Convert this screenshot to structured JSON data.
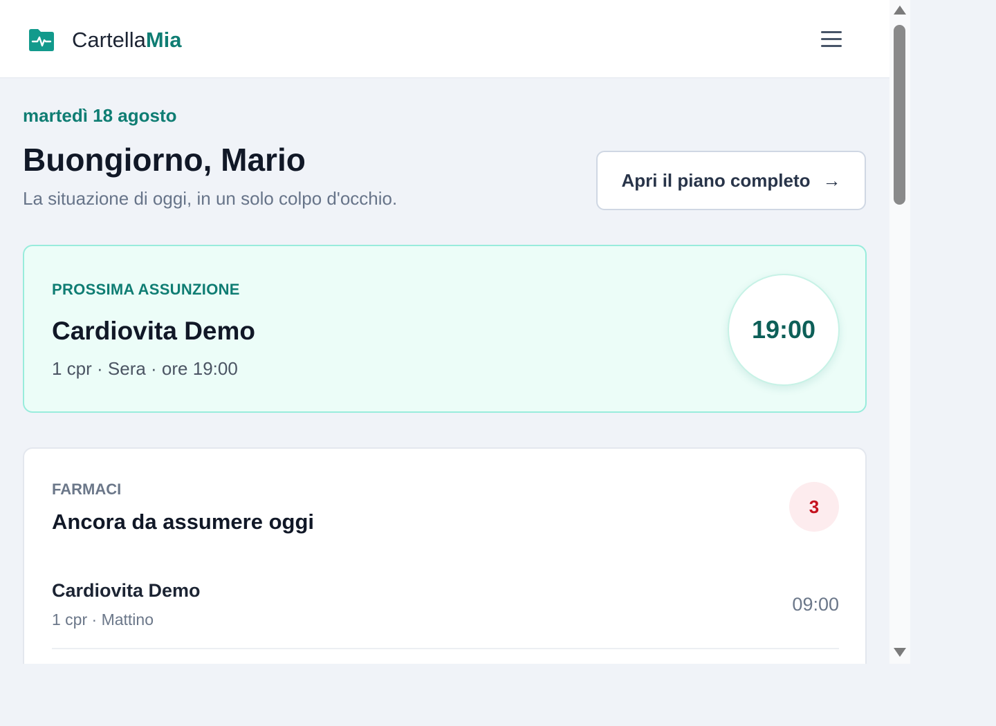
{
  "header": {
    "brand_prefix": "Cartella",
    "brand_accent": "Mia",
    "menu_icon": "hamburger-menu-icon",
    "logo_icon": "folder-pulse-icon"
  },
  "hero": {
    "date": "martedì 18 agosto",
    "greeting": "Buongiorno, Mario",
    "subtitle": "La situazione di oggi, in un solo colpo d'occhio.",
    "plan_button_label": "Apri il piano completo",
    "plan_button_arrow": "→"
  },
  "next_dose": {
    "kicker": "PROSSIMA ASSUNZIONE",
    "name": "Cardiovita Demo",
    "detail": "1 cpr · Sera · ore 19:00",
    "time": "19:00"
  },
  "medications": {
    "kicker": "FARMACI",
    "heading": "Ancora da assumere oggi",
    "count": "3",
    "items": [
      {
        "name": "Cardiovita Demo",
        "detail": "1 cpr · Mattino",
        "time": "09:00"
      }
    ]
  },
  "colors": {
    "accent": "#0f7d73",
    "next_card_bg": "#ecfdf8",
    "badge_bg": "#fdecee",
    "badge_text": "#c4121e"
  }
}
